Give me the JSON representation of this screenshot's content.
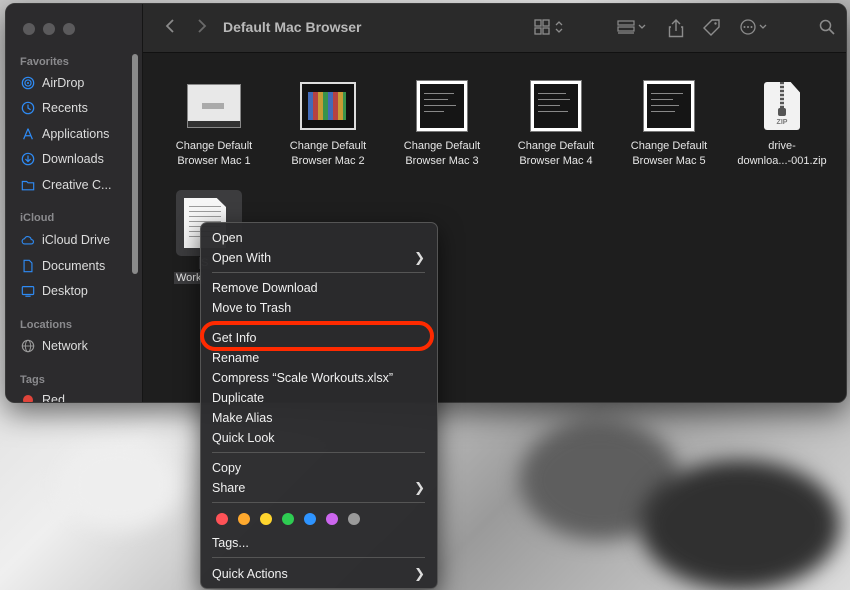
{
  "window": {
    "title": "Default Mac Browser"
  },
  "sidebar": {
    "sections": {
      "favorites": "Favorites",
      "icloud": "iCloud",
      "locations": "Locations",
      "tags": "Tags"
    },
    "favorites": [
      {
        "label": "AirDrop",
        "icon": "airdrop-icon"
      },
      {
        "label": "Recents",
        "icon": "clock-icon"
      },
      {
        "label": "Applications",
        "icon": "applications-icon"
      },
      {
        "label": "Downloads",
        "icon": "download-icon"
      },
      {
        "label": "Creative C...",
        "icon": "folder-icon"
      }
    ],
    "icloud": [
      {
        "label": "iCloud Drive",
        "icon": "cloud-icon"
      },
      {
        "label": "Documents",
        "icon": "document-icon"
      },
      {
        "label": "Desktop",
        "icon": "desktop-icon"
      }
    ],
    "locations": [
      {
        "label": "Network",
        "icon": "globe-icon"
      }
    ],
    "tags": [
      {
        "label": "Red",
        "color": "#e0443a"
      }
    ]
  },
  "files": [
    {
      "line1": "Change Default",
      "line2": "Browser Mac 1"
    },
    {
      "line1": "Change Default",
      "line2": "Browser Mac 2"
    },
    {
      "line1": "Change Default",
      "line2": "Browser Mac 3"
    },
    {
      "line1": "Change Default",
      "line2": "Browser Mac 4"
    },
    {
      "line1": "Change Default",
      "line2": "Browser Mac 5"
    },
    {
      "line1": "drive-",
      "line2": "downloa...-001.zip",
      "zip_label": "ZIP"
    }
  ],
  "selected_file": {
    "line1_partial": "S",
    "line2_partial": "Work"
  },
  "context_menu": {
    "open": "Open",
    "open_with": "Open With",
    "remove_download": "Remove Download",
    "move_to_trash": "Move to Trash",
    "get_info": "Get Info",
    "rename": "Rename",
    "compress": "Compress “Scale Workouts.xlsx”",
    "duplicate": "Duplicate",
    "make_alias": "Make Alias",
    "quick_look": "Quick Look",
    "copy": "Copy",
    "share": "Share",
    "tags": "Tags...",
    "quick_actions": "Quick Actions",
    "tag_colors": [
      "#ff5257",
      "#ffa92e",
      "#ffd52e",
      "#2ecc52",
      "#2e94ff",
      "#cc66ee",
      "#9a9a9a"
    ]
  },
  "accent": {
    "highlight": "#ff2a00",
    "sidebar_icon": "#2e8bf5"
  }
}
